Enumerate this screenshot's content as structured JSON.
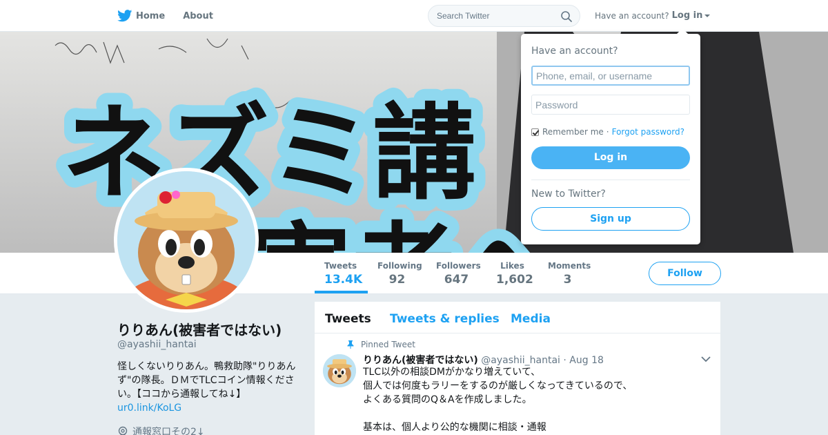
{
  "nav": {
    "home_label": "Home",
    "about_label": "About",
    "search_placeholder": "Search Twitter",
    "have_account": "Have an account?",
    "login_label": "Log in"
  },
  "banner": {
    "headline_line1": "ネズミ講",
    "headline_line2": "被害者へ"
  },
  "stats": [
    {
      "label": "Tweets",
      "value": "13.4K"
    },
    {
      "label": "Following",
      "value": "92"
    },
    {
      "label": "Followers",
      "value": "647"
    },
    {
      "label": "Likes",
      "value": "1,602"
    },
    {
      "label": "Moments",
      "value": "3"
    }
  ],
  "follow_label": "Follow",
  "profile": {
    "name": "りりあん(被害者ではない)",
    "handle": "@ayashii_hantai",
    "bio": "怪しくないりりあん。鴨救助隊\"りりあんず\"の隊長。ＤＭでTLCコイン情報ください。【ココから通報してね↓】",
    "link": "ur0.link/KoLG",
    "location": "通報窓口その2↓"
  },
  "timeline": {
    "tabs": [
      "Tweets",
      "Tweets & replies",
      "Media"
    ],
    "pinned_label": "Pinned Tweet",
    "tweet": {
      "name": "りりあん(被害者ではない)",
      "handle": "@ayashii_hantai",
      "date": "· Aug 18",
      "lines": [
        "TLC以外の相談DMがかなり増えていて、",
        "個人では何度もラリーをするのが厳しくなってきているので、",
        "よくある質問のQ＆Aを作成しました。",
        "",
        "基本は、個人より公的な機関に相談・通報"
      ]
    }
  },
  "login_dropdown": {
    "title": "Have an account?",
    "username_placeholder": "Phone, email, or username",
    "password_placeholder": "Password",
    "remember_label": "Remember me",
    "forgot_label": "Forgot password?",
    "login_button": "Log in",
    "new_label": "New to Twitter?",
    "signup_button": "Sign up"
  },
  "colors": {
    "accent": "#1da1f2",
    "login_button": "#4ab3f4",
    "background": "#e6ecf0"
  }
}
